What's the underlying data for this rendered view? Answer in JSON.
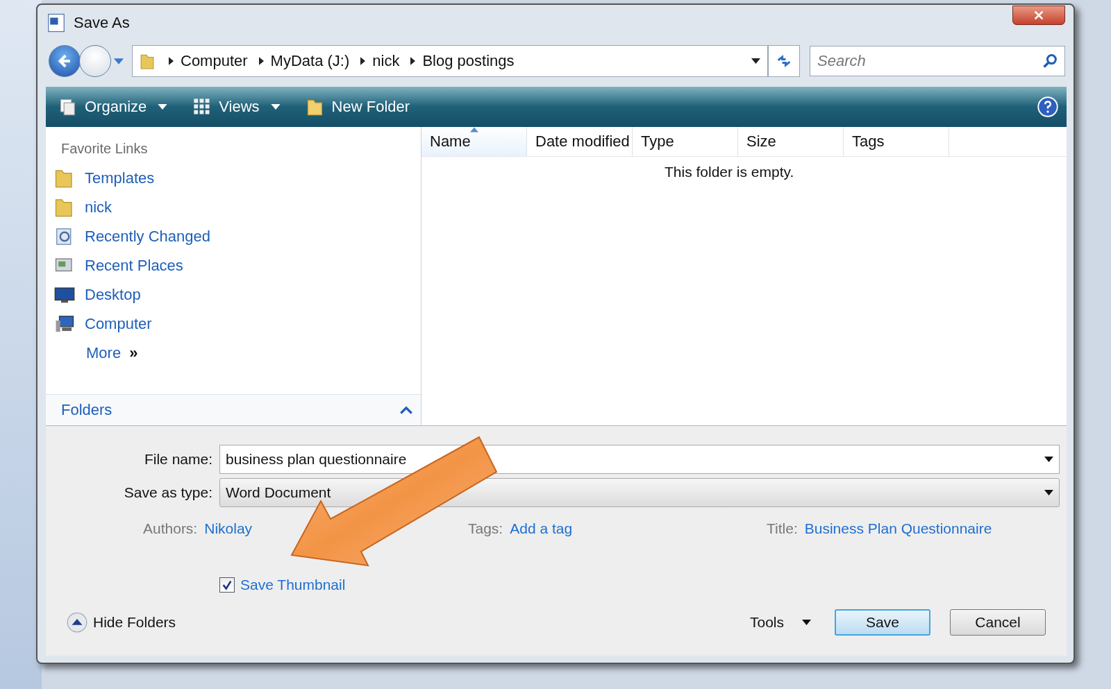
{
  "window": {
    "title": "Save As"
  },
  "address_bar": {
    "breadcrumb": [
      "Computer",
      "MyData (J:)",
      "nick",
      "Blog postings"
    ]
  },
  "search": {
    "placeholder": "Search"
  },
  "toolbar": [
    {
      "label": "Organize",
      "kind": "organize"
    },
    {
      "label": "Views",
      "kind": "views"
    },
    {
      "label": "New Folder",
      "kind": "new-folder"
    }
  ],
  "favorite_links": {
    "title": "Favorite Links",
    "items": [
      {
        "label": "Templates",
        "kind": "folder"
      },
      {
        "label": "nick",
        "kind": "folder"
      },
      {
        "label": "Recently Changed",
        "kind": "recent"
      },
      {
        "label": "Recent Places",
        "kind": "places"
      },
      {
        "label": "Desktop",
        "kind": "desktop"
      },
      {
        "label": "Computer",
        "kind": "computer"
      }
    ],
    "more": "More",
    "more_glyph": "»"
  },
  "folders": {
    "label": "Folders",
    "expanded": true
  },
  "file_list": {
    "columns": [
      {
        "label": "Name",
        "sorted": true
      },
      {
        "label": "Date modified",
        "sorted": false
      },
      {
        "label": "Type",
        "sorted": false
      },
      {
        "label": "Size",
        "sorted": false
      },
      {
        "label": "Tags",
        "sorted": false
      }
    ],
    "empty_message": "This folder is empty."
  },
  "form": {
    "file_name_label": "File name:",
    "file_name": "business plan questionnaire",
    "type_label": "Save as type:",
    "type_value": "Word Document"
  },
  "metadata": [
    {
      "label": "Authors:",
      "value": "Nikolay"
    },
    {
      "label": "Tags:",
      "value": "Add a tag"
    },
    {
      "label": "Title:",
      "value": "Business Plan Questionnaire"
    }
  ],
  "save_thumbnail": {
    "label": "Save Thumbnail",
    "checked": true
  },
  "hide_folders": "Hide Folders",
  "tools": "Tools",
  "buttons": [
    {
      "label": "Save",
      "default": true
    },
    {
      "label": "Cancel",
      "default": false
    }
  ]
}
